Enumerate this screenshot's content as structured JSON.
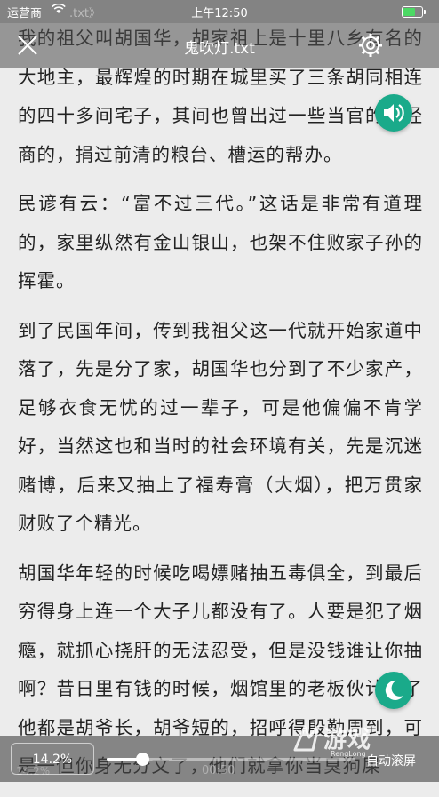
{
  "status_bar": {
    "carrier": "运营商",
    "ghost_text": ".txt》",
    "time": "上午12:50",
    "battery_level": 0.7,
    "battery_color": "#4cd964"
  },
  "header": {
    "title": "鬼吹灯.txt",
    "close_icon": "close-icon",
    "settings_icon": "gear-icon"
  },
  "content": {
    "paragraphs": [
      "我的祖父叫胡国华，胡家祖上是十里八乡有名的大地主，最辉煌的时期在城里买了三条胡同相连的四十多间宅子，其间也曾出过一些当官的，经商的，捐过前清的粮台、槽运的帮办。",
      "民谚有云：“富不过三代。”这话是非常有道理的，家里纵然有金山银山，也架不住败家子孙的挥霍。",
      "到了民国年间，传到我祖父这一代就开始家道中落了，先是分了家，胡国华也分到了不少家产，足够衣食无忧的过一辈子，可是他偏偏不肯学好，当然这也和当时的社会环境有关，先是沉迷赌博，后来又抽上了福寿膏（大烟），把万贯家财败了个精光。",
      "胡国华年轻的时候吃喝嫖赌抽五毒俱全，到最后穷得身上连一个大子儿都没有了。人要是犯了烟瘾，就抓心挠肝的无法忍受，但是没钱谁让你抽啊？昔日里有钱的时候，烟馆里的老板伙计见了他都是胡爷长，胡爷短的，招呼得殷勤周到，可是一但你身无分文了，他们就拿你当臭狗屎"
    ]
  },
  "floating": {
    "audio_icon": "speaker-icon",
    "night_icon": "moon-icon",
    "accent_color": "#1aaa8a"
  },
  "bottom_bar": {
    "percent_label": "14.2%",
    "progress": 0.142,
    "auto_scroll_label": "自动滚屏",
    "underlay_time": "00:50",
    "underlay_percent": "14.2%"
  },
  "watermark": {
    "text": "游戏",
    "sub": "RengLong"
  }
}
